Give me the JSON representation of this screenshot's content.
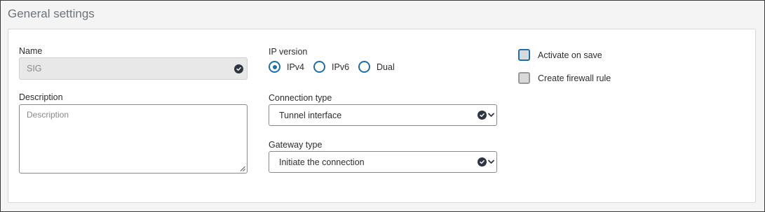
{
  "section": {
    "title": "General settings"
  },
  "name": {
    "label": "Name",
    "value": "SIG",
    "valid_icon": "check-circle-icon"
  },
  "description": {
    "label": "Description",
    "placeholder": "Description",
    "value": ""
  },
  "ip_version": {
    "label": "IP version",
    "options": [
      {
        "label": "IPv4",
        "selected": true
      },
      {
        "label": "IPv6",
        "selected": false
      },
      {
        "label": "Dual",
        "selected": false
      }
    ]
  },
  "connection_type": {
    "label": "Connection type",
    "value": "Tunnel interface"
  },
  "gateway_type": {
    "label": "Gateway type",
    "value": "Initiate the connection"
  },
  "activate_on_save": {
    "label": "Activate on save",
    "checked": false
  },
  "create_firewall_rule": {
    "label": "Create firewall rule",
    "checked": false
  },
  "colors": {
    "accent": "#1e6fa8",
    "badge": "#2c3540",
    "disabled_field": "#e8e8e8"
  }
}
